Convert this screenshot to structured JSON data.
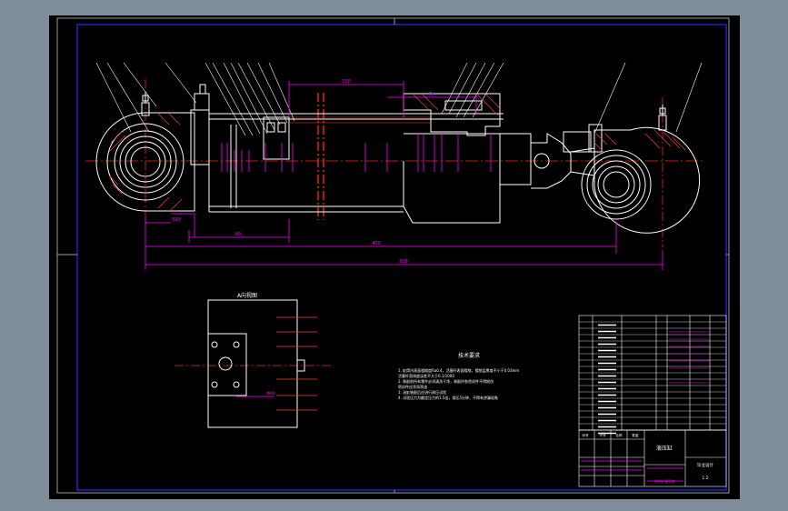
{
  "viewer": {
    "background_color": "#7f8c99",
    "sheet_color": "#000000",
    "frame_color": "#1a1aff",
    "line_colors": {
      "outline": "#ffffff",
      "dimension": "#ff00ff",
      "center": "#ff2020",
      "hatch": "#ff3b3b"
    }
  },
  "section_view": {
    "top_dims": [
      "100",
      "75"
    ],
    "bottom_dims": [
      "60",
      "400",
      "508",
      "590"
    ]
  },
  "detail_view": {
    "title": "A向视图",
    "dim_label": "Φ60"
  },
  "notes": {
    "title": "技术要求",
    "items": [
      "1. 缸筒内表面粗糙度Ra0.4，活塞杆表面镀铬，镀铬层厚度不小于0.03mm",
      "   活塞杆直线度误差不大于0.1/1000",
      "2. 装配前所有零件必须清洗干净，装配时各密封件不得损伤",
      "   密封件应涂润滑油",
      "3. 油缸装配后应进行耐压试验",
      "4. 试验压力为额定压力的1.5倍，保压5分钟，不得有渗漏现象"
    ]
  },
  "title_block": {
    "drawing_name": "液压缸",
    "school": "毕业设计",
    "scale": "1:2",
    "sheet": "共1张 第1张",
    "header_cells": [
      "序号",
      "代号",
      "名称",
      "数量",
      "材料",
      "备注"
    ]
  },
  "icons": [
    "cad-sheet-icon"
  ]
}
